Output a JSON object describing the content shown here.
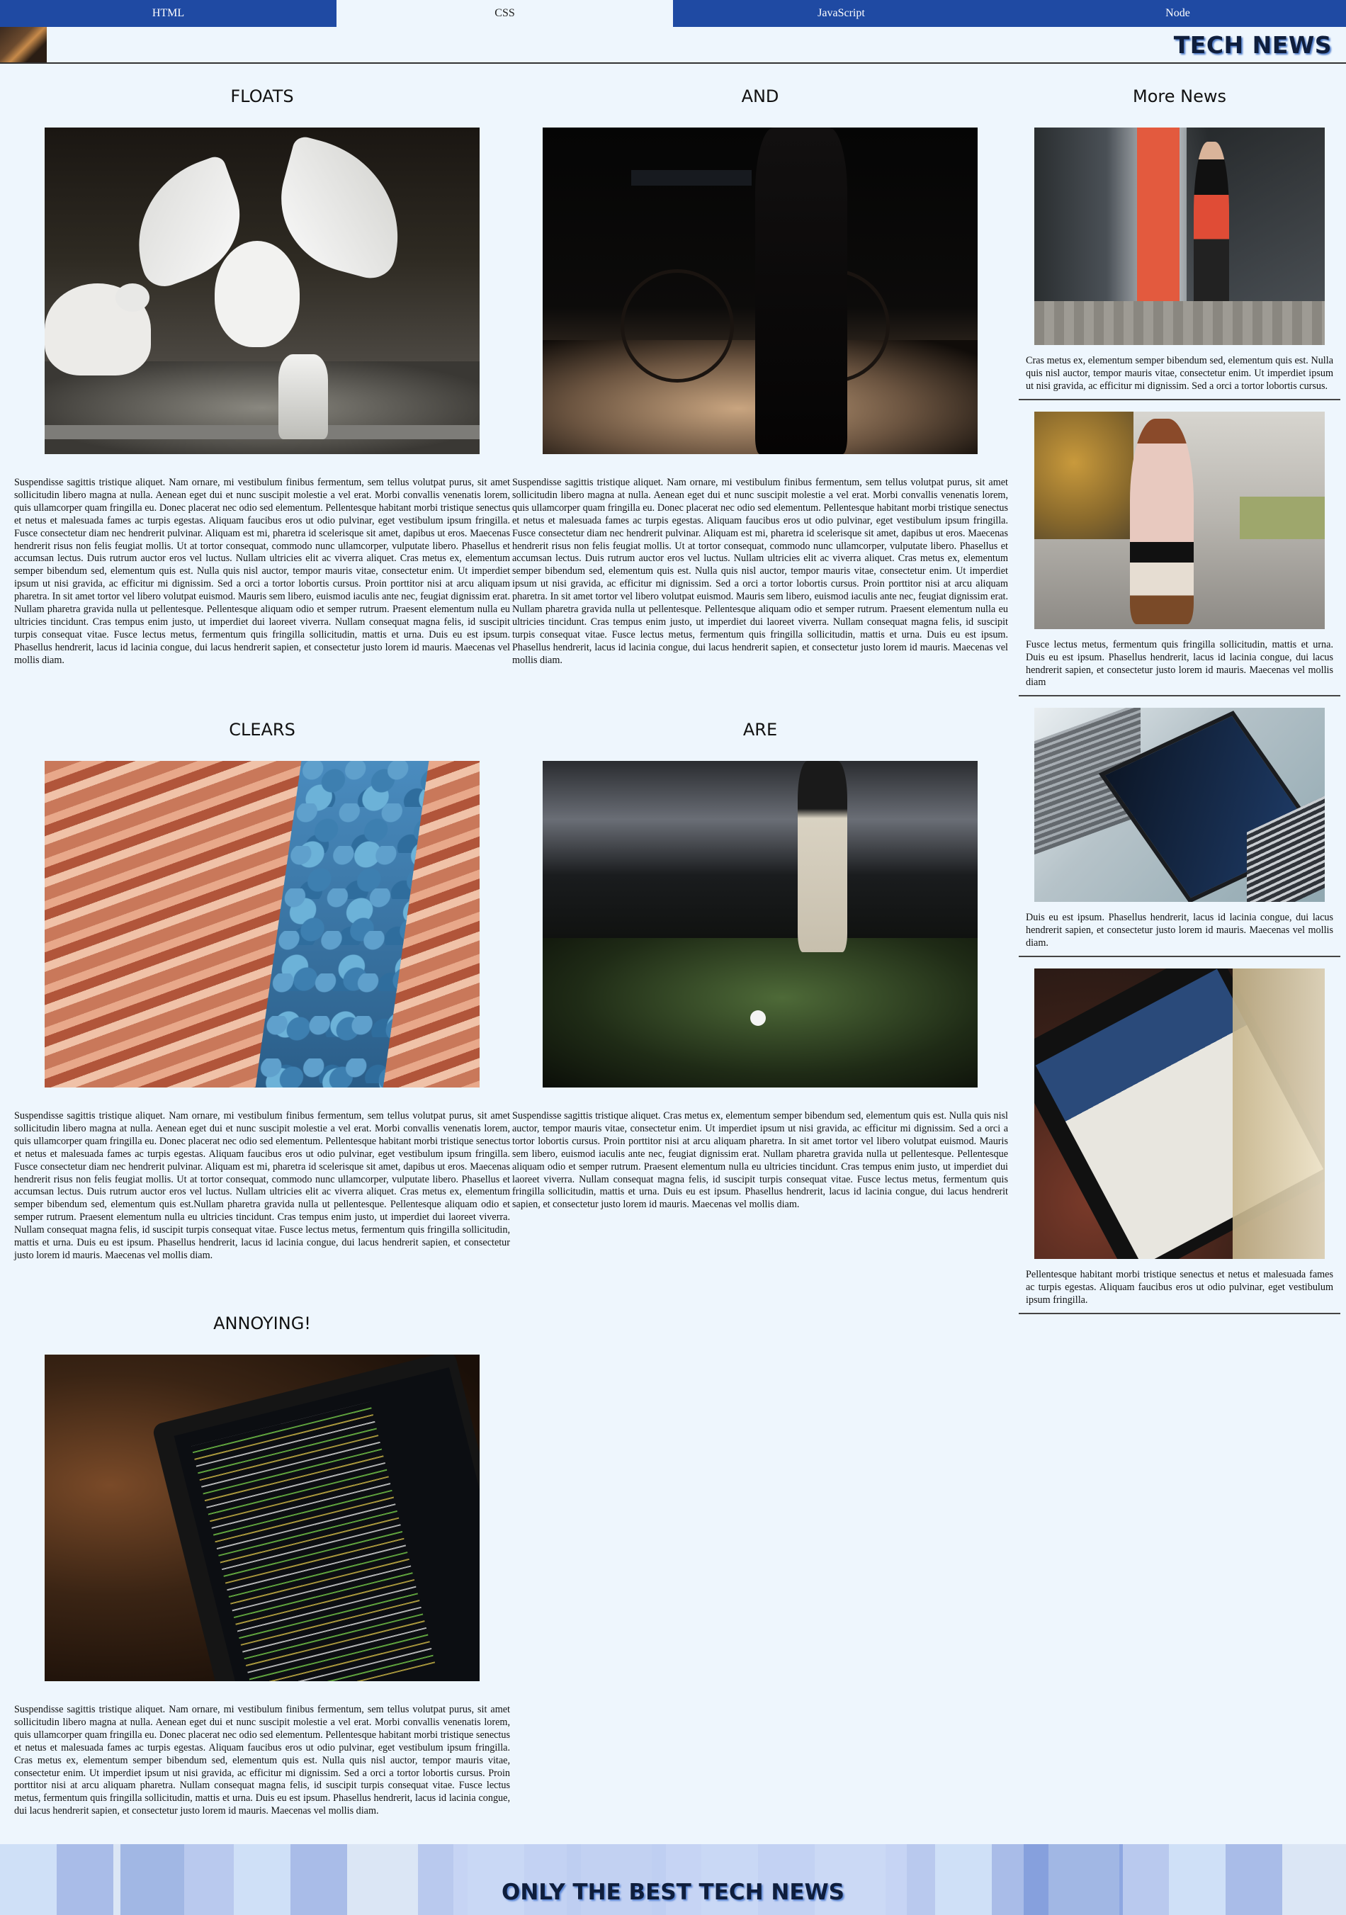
{
  "nav": {
    "tabs": [
      "HTML",
      "CSS",
      "JavaScript",
      "Node"
    ],
    "active": "CSS"
  },
  "header": {
    "title": "TECH NEWS"
  },
  "articles": [
    {
      "title": "FLOATS",
      "image": "seagulls-photo",
      "text": "Suspendisse sagittis tristique aliquet. Nam ornare, mi vestibulum finibus fermentum, sem tellus volutpat purus, sit amet sollicitudin libero magna at nulla. Aenean eget dui et nunc suscipit molestie a vel erat. Morbi convallis venenatis lorem, quis ullamcorper quam fringilla eu. Donec placerat nec odio sed elementum. Pellentesque habitant morbi tristique senectus et netus et malesuada fames ac turpis egestas. Aliquam faucibus eros ut odio pulvinar, eget vestibulum ipsum fringilla. Fusce consectetur diam nec hendrerit pulvinar. Aliquam est mi, pharetra id scelerisque sit amet, dapibus ut eros. Maecenas hendrerit risus non felis feugiat mollis. Ut at tortor consequat, commodo nunc ullamcorper, vulputate libero. Phasellus et accumsan lectus. Duis rutrum auctor eros vel luctus. Nullam ultricies elit ac viverra aliquet. Cras metus ex, elementum semper bibendum sed, elementum quis est. Nulla quis nisl auctor, tempor mauris vitae, consectetur enim. Ut imperdiet ipsum ut nisi gravida, ac efficitur mi dignissim. Sed a orci a tortor lobortis cursus. Proin porttitor nisi at arcu aliquam pharetra. In sit amet tortor vel libero volutpat euismod. Mauris sem libero, euismod iaculis ante nec, feugiat dignissim erat. Nullam pharetra gravida nulla ut pellentesque. Pellentesque aliquam odio et semper rutrum. Praesent elementum nulla eu ultricies tincidunt. Cras tempus enim justo, ut imperdiet dui laoreet viverra. Nullam consequat magna felis, id suscipit turpis consequat vitae. Fusce lectus metus, fermentum quis fringilla sollicitudin, mattis et urna. Duis eu est ipsum. Phasellus hendrerit, lacus id lacinia congue, dui lacus hendrerit sapien, et consectetur justo lorem id mauris. Maecenas vel mollis diam."
    },
    {
      "title": "AND",
      "image": "bicycle-photo",
      "text": "Suspendisse sagittis tristique aliquet. Nam ornare, mi vestibulum finibus fermentum, sem tellus volutpat purus, sit amet sollicitudin libero magna at nulla. Aenean eget dui et nunc suscipit molestie a vel erat. Morbi convallis venenatis lorem, quis ullamcorper quam fringilla eu. Donec placerat nec odio sed elementum. Pellentesque habitant morbi tristique senectus et netus et malesuada fames ac turpis egestas. Aliquam faucibus eros ut odio pulvinar, eget vestibulum ipsum fringilla. Fusce consectetur diam nec hendrerit pulvinar. Aliquam est mi, pharetra id scelerisque sit amet, dapibus ut eros. Maecenas hendrerit risus non felis feugiat mollis. Ut at tortor consequat, commodo nunc ullamcorper, vulputate libero. Phasellus et accumsan lectus. Duis rutrum auctor eros vel luctus. Nullam ultricies elit ac viverra aliquet. Cras metus ex, elementum semper bibendum sed, elementum quis est. Nulla quis nisl auctor, tempor mauris vitae, consectetur enim. Ut imperdiet ipsum ut nisi gravida, ac efficitur mi dignissim. Sed a orci a tortor lobortis cursus. Proin porttitor nisi at arcu aliquam pharetra. In sit amet tortor vel libero volutpat euismod. Mauris sem libero, euismod iaculis ante nec, feugiat dignissim erat. Nullam pharetra gravida nulla ut pellentesque. Pellentesque aliquam odio et semper rutrum. Praesent elementum nulla eu ultricies tincidunt. Cras tempus enim justo, ut imperdiet dui laoreet viverra. Nullam consequat magna felis, id suscipit turpis consequat vitae. Fusce lectus metus, fermentum quis fringilla sollicitudin, mattis et urna. Duis eu est ipsum. Phasellus hendrerit, lacus id lacinia congue, dui lacus hendrerit sapien, et consectetur justo lorem id mauris. Maecenas vel mollis diam."
    },
    {
      "title": "CLEARS",
      "image": "rock-canyon-photo",
      "text": "Suspendisse sagittis tristique aliquet. Nam ornare, mi vestibulum finibus fermentum, sem tellus volutpat purus, sit amet sollicitudin libero magna at nulla. Aenean eget dui et nunc suscipit molestie a vel erat. Morbi convallis venenatis lorem, quis ullamcorper quam fringilla eu. Donec placerat nec odio sed elementum. Pellentesque habitant morbi tristique senectus et netus et malesuada fames ac turpis egestas. Aliquam faucibus eros ut odio pulvinar, eget vestibulum ipsum fringilla. Fusce consectetur diam nec hendrerit pulvinar. Aliquam est mi, pharetra id scelerisque sit amet, dapibus ut eros. Maecenas hendrerit risus non felis feugiat mollis. Ut at tortor consequat, commodo nunc ullamcorper, vulputate libero. Phasellus et accumsan lectus. Duis rutrum auctor eros vel luctus. Nullam ultricies elit ac viverra aliquet. Cras metus ex, elementum semper bibendum sed, elementum quis est.Nullam pharetra gravida nulla ut pellentesque. Pellentesque aliquam odio et semper rutrum. Praesent elementum nulla eu ultricies tincidunt. Cras tempus enim justo, ut imperdiet dui laoreet viverra. Nullam consequat magna felis, id suscipit turpis consequat vitae. Fusce lectus metus, fermentum quis fringilla sollicitudin, mattis et urna. Duis eu est ipsum. Phasellus hendrerit, lacus id lacinia congue, dui lacus hendrerit sapien, et consectetur justo lorem id mauris. Maecenas vel mollis diam."
    },
    {
      "title": "ARE",
      "image": "golf-photo",
      "text": "Suspendisse sagittis tristique aliquet. Cras metus ex, elementum semper bibendum sed, elementum quis est. Nulla quis nisl auctor, tempor mauris vitae, consectetur enim. Ut imperdiet ipsum ut nisi gravida, ac efficitur mi dignissim. Sed a orci a tortor lobortis cursus. Proin porttitor nisi at arcu aliquam pharetra. In sit amet tortor vel libero volutpat euismod. Mauris sem libero, euismod iaculis ante nec, feugiat dignissim erat. Nullam pharetra gravida nulla ut pellentesque. Pellentesque aliquam odio et semper rutrum. Praesent elementum nulla eu ultricies tincidunt. Cras tempus enim justo, ut imperdiet dui laoreet viverra. Nullam consequat magna felis, id suscipit turpis consequat vitae. Fusce lectus metus, fermentum quis fringilla sollicitudin, mattis et urna. Duis eu est ipsum. Phasellus hendrerit, lacus id lacinia congue, dui lacus hendrerit sapien, et consectetur justo lorem id mauris. Maecenas vel mollis diam."
    },
    {
      "title": "ANNOYING!",
      "image": "code-laptop-photo",
      "text": "Suspendisse sagittis tristique aliquet. Nam ornare, mi vestibulum finibus fermentum, sem tellus volutpat purus, sit amet sollicitudin libero magna at nulla. Aenean eget dui et nunc suscipit molestie a vel erat. Morbi convallis venenatis lorem, quis ullamcorper quam fringilla eu. Donec placerat nec odio sed elementum. Pellentesque habitant morbi tristique senectus et netus et malesuada fames ac turpis egestas. Aliquam faucibus eros ut odio pulvinar, eget vestibulum ipsum fringilla. Cras metus ex, elementum semper bibendum sed, elementum quis est. Nulla quis nisl auctor, tempor mauris vitae, consectetur enim. Ut imperdiet ipsum ut nisi gravida, ac efficitur mi dignissim. Sed a orci a tortor lobortis cursus. Proin porttitor nisi at arcu aliquam pharetra. Nullam consequat magna felis, id suscipit turpis consequat vitae. Fusce lectus metus, fermentum quis fringilla sollicitudin, mattis et urna. Duis eu est ipsum. Phasellus hendrerit, lacus id lacinia congue, dui lacus hendrerit sapien, et consectetur justo lorem id mauris. Maecenas vel mollis diam."
    }
  ],
  "sidebar": {
    "title": "More News",
    "items": [
      {
        "image": "woman-phone-photo",
        "text": "Cras metus ex, elementum semper bibendum sed, elementum quis est. Nulla quis nisl auctor, tempor mauris vitae, consectetur enim. Ut imperdiet ipsum ut nisi gravida, ac efficitur mi dignissim. Sed a orci a tortor lobortis cursus."
      },
      {
        "image": "woman-coat-photo",
        "text": "Fusce lectus metus, fermentum quis fringilla sollicitudin, mattis et urna. Duis eu est ipsum. Phasellus hendrerit, lacus id lacinia congue, dui lacus hendrerit sapien, et consectetur justo lorem id mauris. Maecenas vel mollis diam"
      },
      {
        "image": "laptop-photo",
        "text": "Duis eu est ipsum. Phasellus hendrerit, lacus id lacinia congue, dui lacus hendrerit sapien, et consectetur justo lorem id mauris. Maecenas vel mollis diam."
      },
      {
        "image": "tablet-welcome-photo",
        "text": "Pellentesque habitant morbi tristique senectus et netus et malesuada fames ac turpis egestas. Aliquam faucibus eros ut odio pulvinar, eget vestibulum ipsum fringilla."
      }
    ]
  },
  "footer": {
    "text": "ONLY THE BEST TECH NEWS"
  },
  "colors": {
    "nav_bg": "#1f4aa3",
    "page_bg": "#eef6fd",
    "title_shadow": "#4b79c9"
  }
}
